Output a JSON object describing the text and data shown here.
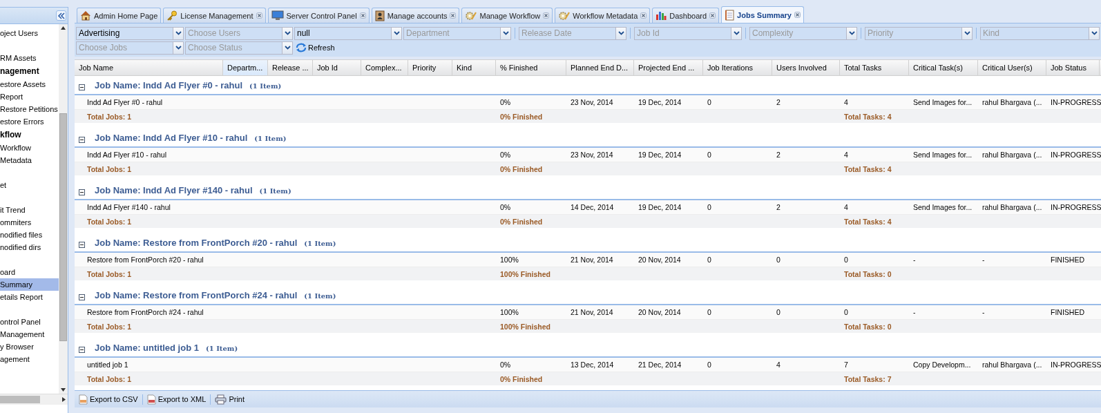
{
  "sidebar": {
    "sections": [
      [
        {
          "label": "oject Users",
          "kind": "item",
          "selected": false
        }
      ],
      [
        {
          "label": "RM Assets",
          "kind": "item",
          "selected": false
        },
        {
          "label": "nagement",
          "kind": "header",
          "selected": false
        },
        {
          "label": "estore Assets",
          "kind": "item",
          "selected": false
        },
        {
          "label": "Report",
          "kind": "item",
          "selected": false
        },
        {
          "label": "Restore Petitions",
          "kind": "item",
          "selected": false
        },
        {
          "label": "estore Errors",
          "kind": "item",
          "selected": false
        },
        {
          "label": "kflow",
          "kind": "header",
          "selected": false
        },
        {
          "label": "Workflow",
          "kind": "item",
          "selected": false
        },
        {
          "label": "Metadata",
          "kind": "item",
          "selected": false
        }
      ],
      [
        {
          "label": "et",
          "kind": "item",
          "selected": false
        }
      ],
      [
        {
          "label": "it Trend",
          "kind": "item",
          "selected": false
        },
        {
          "label": "ommiters",
          "kind": "item",
          "selected": false
        },
        {
          "label": "nodified files",
          "kind": "item",
          "selected": false
        },
        {
          "label": "nodified dirs",
          "kind": "item",
          "selected": false
        }
      ],
      [
        {
          "label": "oard",
          "kind": "item",
          "selected": false
        },
        {
          "label": "Summary",
          "kind": "item",
          "selected": true
        },
        {
          "label": "etails Report",
          "kind": "item",
          "selected": false
        }
      ],
      [
        {
          "label": "ontrol Panel",
          "kind": "item",
          "selected": false
        },
        {
          "label": "Management",
          "kind": "item",
          "selected": false
        },
        {
          "label": "y Browser",
          "kind": "item",
          "selected": false
        },
        {
          "label": "agement",
          "kind": "item",
          "selected": false
        }
      ]
    ]
  },
  "tabs": [
    {
      "label": "Admin Home Page",
      "closable": false,
      "selected": false
    },
    {
      "label": "License Management",
      "closable": true,
      "selected": false
    },
    {
      "label": "Server Control Panel",
      "closable": true,
      "selected": false
    },
    {
      "label": "Manage accounts",
      "closable": true,
      "selected": false
    },
    {
      "label": "Manage Workflow",
      "closable": true,
      "selected": false
    },
    {
      "label": "Workflow Metadata",
      "closable": true,
      "selected": false
    },
    {
      "label": "Dashboard",
      "closable": true,
      "selected": false
    },
    {
      "label": "Jobs Summary",
      "closable": true,
      "selected": true
    }
  ],
  "filters": [
    [
      {
        "value": "Advertising"
      },
      {
        "placeholder": "Choose Users"
      },
      {
        "value": "null"
      },
      {
        "placeholder": "Department"
      },
      {
        "placeholder": "Release Date",
        "separated": true
      },
      {
        "placeholder": "Job Id",
        "separated": true
      },
      {
        "placeholder": "Complexity",
        "separated": true
      },
      {
        "placeholder": "Priority",
        "separated": true
      },
      {
        "placeholder": "Kind",
        "separated": true
      }
    ],
    [
      {
        "placeholder": "Choose Jobs"
      },
      {
        "placeholder": "Choose Status"
      }
    ]
  ],
  "refresh_button": "Refresh",
  "table": {
    "columns": [
      {
        "label": "Job Name",
        "sorted": false
      },
      {
        "label": "Departm...",
        "sorted": true
      },
      {
        "label": "Release ...",
        "sorted": false
      },
      {
        "label": "Job Id",
        "sorted": false
      },
      {
        "label": "Complex...",
        "sorted": false
      },
      {
        "label": "Priority",
        "sorted": false
      },
      {
        "label": "Kind",
        "sorted": false
      },
      {
        "label": "% Finished",
        "sorted": false
      },
      {
        "label": "Planned End D...",
        "sorted": false
      },
      {
        "label": "Projected End ...",
        "sorted": false
      },
      {
        "label": "Job Iterations",
        "sorted": false
      },
      {
        "label": "Users Involved",
        "sorted": false
      },
      {
        "label": "Total Tasks",
        "sorted": false
      },
      {
        "label": "Critical Task(s)",
        "sorted": false
      },
      {
        "label": "Critical User(s)",
        "sorted": false
      },
      {
        "label": "Job Status",
        "sorted": false
      }
    ],
    "groups": [
      {
        "title": "Job Name: Indd Ad Flyer #0 - rahul",
        "count": "(1 Item)",
        "expanded": true,
        "row": {
          "job_name": "Indd Ad Flyer #0 - rahul",
          "finished": "0%",
          "planned_end": "23 Nov, 2014",
          "projected_end": "19 Dec, 2014",
          "iterations": "0",
          "users_involved": "2",
          "total_tasks": "4",
          "critical_tasks": "Send Images for...",
          "critical_users": "rahul Bhargava (...",
          "job_status": "IN-PROGRESS"
        },
        "summary": {
          "total_jobs": "Total Jobs: 1",
          "finished": "0% Finished",
          "total_tasks": "Total Tasks: 4"
        }
      },
      {
        "title": "Job Name: Indd Ad Flyer #10 - rahul",
        "count": "(1 Item)",
        "expanded": true,
        "row": {
          "job_name": "Indd Ad Flyer #10 - rahul",
          "finished": "0%",
          "planned_end": "23 Nov, 2014",
          "projected_end": "19 Dec, 2014",
          "iterations": "0",
          "users_involved": "2",
          "total_tasks": "4",
          "critical_tasks": "Send Images for...",
          "critical_users": "rahul Bhargava (...",
          "job_status": "IN-PROGRESS"
        },
        "summary": {
          "total_jobs": "Total Jobs: 1",
          "finished": "0% Finished",
          "total_tasks": "Total Tasks: 4"
        }
      },
      {
        "title": "Job Name: Indd Ad Flyer #140 - rahul",
        "count": "(1 Item)",
        "expanded": true,
        "row": {
          "job_name": "Indd Ad Flyer #140 - rahul",
          "finished": "0%",
          "planned_end": "14 Dec, 2014",
          "projected_end": "19 Dec, 2014",
          "iterations": "0",
          "users_involved": "2",
          "total_tasks": "4",
          "critical_tasks": "Send Images for...",
          "critical_users": "rahul Bhargava (...",
          "job_status": "IN-PROGRESS"
        },
        "summary": {
          "total_jobs": "Total Jobs: 1",
          "finished": "0% Finished",
          "total_tasks": "Total Tasks: 4"
        }
      },
      {
        "title": "Job Name: Restore from FrontPorch #20 - rahul",
        "count": "(1 Item)",
        "expanded": true,
        "row": {
          "job_name": "Restore from FrontPorch #20 - rahul",
          "finished": "100%",
          "planned_end": "21 Nov, 2014",
          "projected_end": "20 Nov, 2014",
          "iterations": "0",
          "users_involved": "0",
          "total_tasks": "0",
          "critical_tasks": "-",
          "critical_users": "-",
          "job_status": "FINISHED"
        },
        "summary": {
          "total_jobs": "Total Jobs: 1",
          "finished": "100% Finished",
          "total_tasks": "Total Tasks: 0"
        }
      },
      {
        "title": "Job Name: Restore from FrontPorch #24 - rahul",
        "count": "(1 Item)",
        "expanded": true,
        "row": {
          "job_name": "Restore from FrontPorch #24 - rahul",
          "finished": "100%",
          "planned_end": "21 Nov, 2014",
          "projected_end": "20 Nov, 2014",
          "iterations": "0",
          "users_involved": "0",
          "total_tasks": "0",
          "critical_tasks": "-",
          "critical_users": "-",
          "job_status": "FINISHED"
        },
        "summary": {
          "total_jobs": "Total Jobs: 1",
          "finished": "100% Finished",
          "total_tasks": "Total Tasks: 0"
        }
      },
      {
        "title": "Job Name: untitled job 1",
        "count": "(1 Item)",
        "expanded": true,
        "row": {
          "job_name": "untitled job 1",
          "finished": "0%",
          "planned_end": "13 Dec, 2014",
          "projected_end": "21 Dec, 2014",
          "iterations": "0",
          "users_involved": "4",
          "total_tasks": "7",
          "critical_tasks": "Copy Developm...",
          "critical_users": "rahul Bhargava (...",
          "job_status": "IN-PROGRESS"
        },
        "summary": {
          "total_jobs": "Total Jobs: 1",
          "finished": "0% Finished",
          "total_tasks": "Total Tasks: 7"
        }
      }
    ]
  },
  "footer": [
    {
      "label": "Export to CSV",
      "kind": "export"
    },
    {
      "label": "Export to XML",
      "kind": "export"
    },
    {
      "label": "Print",
      "kind": "print"
    }
  ]
}
